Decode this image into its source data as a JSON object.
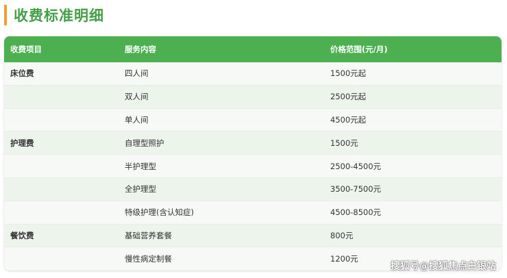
{
  "title": "收费标准明细",
  "header": {
    "col1": "收费项目",
    "col2": "服务内容",
    "col3": "价格范围(元/月)"
  },
  "rows": [
    {
      "category": "床位费",
      "service": "四人间",
      "price": "1500元起"
    },
    {
      "category": "",
      "service": "双人间",
      "price": "2500元起"
    },
    {
      "category": "",
      "service": "单人间",
      "price": "4500元起"
    },
    {
      "category": "护理费",
      "service": "自理型照护",
      "price": "1500元"
    },
    {
      "category": "",
      "service": "半护理型",
      "price": "2500-4500元"
    },
    {
      "category": "",
      "service": "全护理型",
      "price": "3500-7500元"
    },
    {
      "category": "",
      "service": "特级护理(含认知症)",
      "price": "4500-8500元"
    },
    {
      "category": "餐饮费",
      "service": "基础营养套餐",
      "price": "800元"
    },
    {
      "category": "",
      "service": "慢性病定制餐",
      "price": "1200元"
    }
  ],
  "watermark": "搜狐号@搜狐焦点白银站",
  "colors": {
    "accent": "#4caf50",
    "title": "#43a047",
    "bar": "#f0a030"
  }
}
